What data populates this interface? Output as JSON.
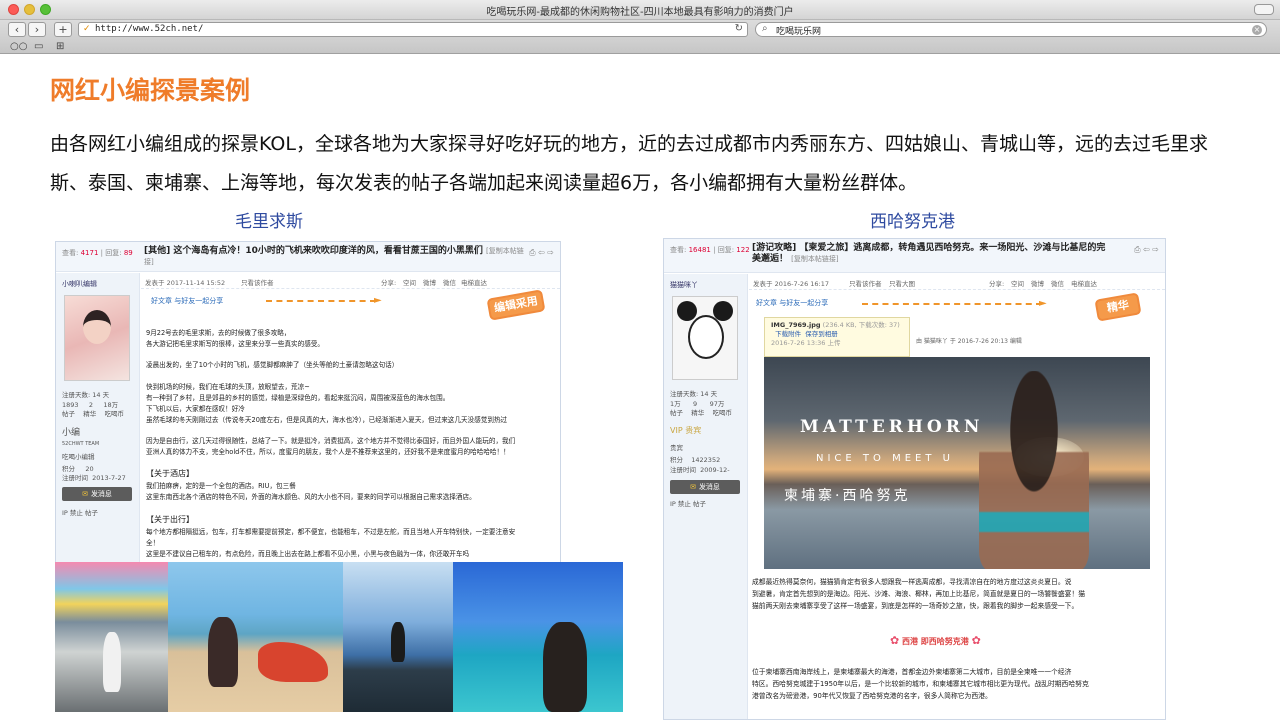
{
  "browser": {
    "window_title": "吃喝玩乐网-最成都的休闲购物社区-四川本地最具有影响力的消费门户",
    "url": "http://www.52ch.net/",
    "search_query": "吃喝玩乐网"
  },
  "page": {
    "heading": "网红小编探景案例",
    "description": "由各网红小编组成的探景KOL，全球各地为大家探寻好吃好玩的地方，近的去过成都市内秀丽东方、四姑娘山、青城山等，远的去过毛里求斯、泰国、柬埔寨、上海等地，每次发表的帖子各端加起来阅读量超6万，各小编都拥有大量粉丝群体。",
    "left_caption": "毛里求斯",
    "right_caption": "西哈努克港"
  },
  "left_post": {
    "views_label": "查看:",
    "views": "4171",
    "replies_label": "回复:",
    "replies": "89",
    "title": "[其他] 这个海岛有点冷！10小时的飞机来吹吹印度洋的风，看看甘蔗王国的小黑黑们",
    "copy_link": "[复制本帖链接]",
    "author": "小喇叭编辑",
    "posted": "发表于 2017-11-14 15:52",
    "only_author": "只看该作者",
    "share_label": "分享:",
    "share_targets": [
      "空间",
      "微博",
      "微信"
    ],
    "text_reader": "电梯直达",
    "good_article": "好文章 与好友一起分享",
    "stamp": "编辑采用",
    "stats_line1": "注册天数: 14 天",
    "stats_nums": [
      "1893",
      "2",
      "18万"
    ],
    "stats_labels": [
      "帖子",
      "精华",
      "吃喝币"
    ],
    "level": "小编",
    "level_en": "52CHWT TEAM",
    "group": "吃喝小编辑",
    "points_label": "积分",
    "points": "20",
    "reg_label": "注册时间",
    "reg": "2013-7-27",
    "msg_button": "发消息",
    "ip_line": "IP 禁止 帖子",
    "paragraphs": [
      "9月22号去的毛里求斯，去的时候做了很多攻略，",
      "各大游记把毛里求斯写的很棒，这里来分享一些真实的感受。",
      "凌晨出发的，坐了10个小时的飞机，感觉脚都麻肿了（坐头等舱的土豪请忽略这句话）",
      "快到机场的时候，我们在毛球的头顶，放眼望去，荒凉~",
      "有一种到了乡村，且是郊县的乡村的感觉，绿植是深绿色的，看起来挺沉闷，周围被深蓝色的海水包围。",
      "下飞机以后，大家都在感叹！好冷",
      "虽然毛球的冬天刚刚过去（传说冬天20度左右，但是风真的大，海水也冷），已经渐渐进入夏天，但过来这几天没感觉到热过",
      "因为是自由行，这几天过得很随性，总结了一下。就是挺冷，消费挺高，这个地方并不觉得比泰国好，而且外国人能玩的，我们",
      "亚洲人真的体力不支，完全hold不住，所以，度蜜月的朋友，我个人是不推荐来这里的，还好我不是来度蜜月的哈哈哈哈！！"
    ],
    "section1": "【关于酒店】",
    "hotel_lines": [
      "我们拍麻痹，定的是一个全包的酒店。RIU，包三餐",
      "这里东南西北各个酒店的特色不同，外面的海水颜色、风的大小也不同，要来的同学可以根据自己需求选择酒店。"
    ],
    "section2": "【关于出行】",
    "travel_lines": [
      "每个地方都相隔挺远，包车，打车都需要提前预定，都不便宜，也能租车，不过是左舵，而且当地人开车特别快，一定要注意安",
      "全！",
      "这里是不建议自己租车的，有点危险，而且晚上出去在路上都看不见小黑，小黑与夜色融为一体，你还敢开车吗"
    ]
  },
  "right_post": {
    "views_label": "查看:",
    "views": "16481",
    "replies_label": "回复:",
    "replies": "122",
    "title": "[游记攻略] 【柬爱之旅】逃离成都，转角遇见西哈努克。来一场阳光、沙滩与比基尼的完美邂逅！",
    "copy_link": "[复制本帖链接]",
    "author": "猫猫咪丫",
    "posted": "发表于 2016-7-26 16:17",
    "only_author": "只看该作者",
    "only_large": "只看大图",
    "share_label": "分享:",
    "share_targets": [
      "空间",
      "微博",
      "微信"
    ],
    "text_reader": "电梯直达",
    "good_article": "好文章 与好友一起分享",
    "stamp": "精华",
    "stats_line1": "注册天数: 14 天",
    "stats_nums": [
      "1万",
      "9",
      "97万"
    ],
    "stats_labels": [
      "帖子",
      "精华",
      "吃喝币"
    ],
    "level": "VIP 贵宾",
    "group": "贵宾",
    "points_label": "积分",
    "points": "1422352",
    "reg_label": "注册时间",
    "reg": "2009-12-",
    "msg_button": "发消息",
    "ip_line": "IP 禁止 帖子",
    "tooltip_file": "IMG_7969.jpg",
    "tooltip_meta": "(236.4 KB, 下载次数: 37)",
    "tooltip_download": "下载附件",
    "tooltip_save": "保存到相册",
    "tooltip_date": "2016-7-26 13:36 上传",
    "edit_note": "由 猫猫咪丫 于 2016-7-26 20:13 编辑",
    "photo_title": "MATTERHORN",
    "photo_sub": "NICE TO MEET U",
    "photo_cn": "柬埔寨·西哈努克",
    "body_lines": [
      "成都最近热得莫奈何，猫猫猜肯定有很多人想跟我一样逃离成都，寻找清凉自在的地方度过这炎炎夏日。说",
      "到避暑，肯定首先想到的是海边。阳光、沙滩、海浪、椰林，再加上比基尼，简直就是夏日的一场饕餮盛宴！猫",
      "猫前两天刚去柬埔寨享受了这样一场盛宴，到底是怎样的一场奇妙之旅，快，跟着我的脚步一起来感受一下。"
    ],
    "flower_title": "西港 即西哈努克港",
    "body_lines2": [
      "位于柬埔寨西南海岸线上，是柬埔寨最大的海港，首都金边外柬埔寨第二大城市，目前是全柬唯一一个经济",
      "特区。西哈努克城建于1950年以后，是一个比较新的城市，和柬埔寨其它城市相比更为现代。战乱时期西哈努克",
      "港曾改名为磅逊港，90年代又恢复了西哈努克港的名字，很多人简称它为西港。"
    ]
  }
}
